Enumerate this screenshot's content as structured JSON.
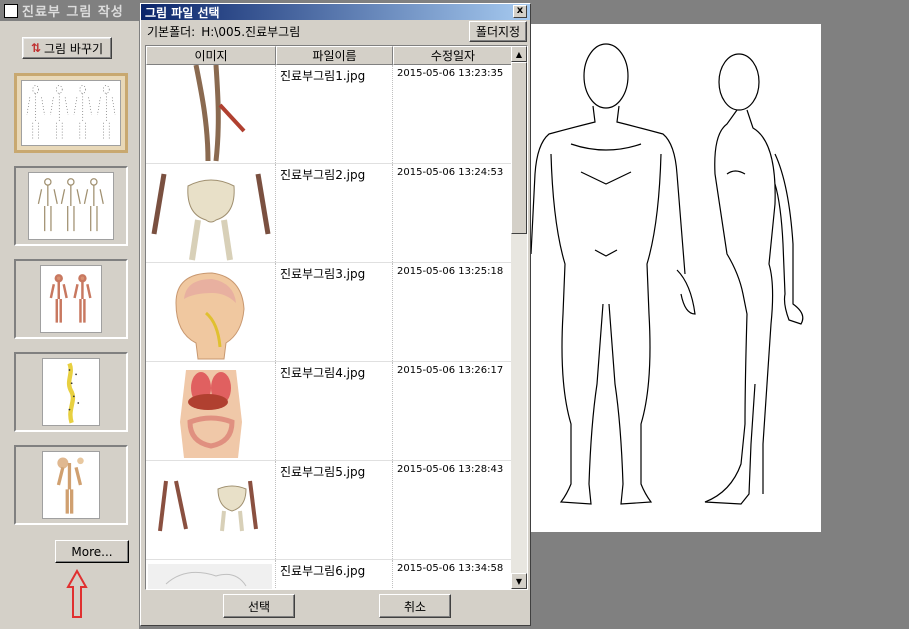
{
  "app": {
    "title": "진료부 그림 작성"
  },
  "left_panel": {
    "swap_button": "그림 바꾸기",
    "more_button": "More...",
    "thumbnails": [
      "thumb-1",
      "thumb-2",
      "thumb-3",
      "thumb-4",
      "thumb-5"
    ]
  },
  "dialog": {
    "title": "그림 파일 선택",
    "close_label": "x",
    "folder_label": "기본폴더:",
    "folder_path": "H:\\005.진료부그림",
    "folder_button": "폴더지정",
    "columns": [
      "이미지",
      "파일이름",
      "수정일자"
    ],
    "rows": [
      {
        "name": "진료부그림1.jpg",
        "date": "2015-05-06 13:23:35"
      },
      {
        "name": "진료부그림2.jpg",
        "date": "2015-05-06 13:24:53"
      },
      {
        "name": "진료부그림3.jpg",
        "date": "2015-05-06 13:25:18"
      },
      {
        "name": "진료부그림4.jpg",
        "date": "2015-05-06 13:26:17"
      },
      {
        "name": "진료부그림5.jpg",
        "date": "2015-05-06 13:28:43"
      },
      {
        "name": "진료부그림6.jpg",
        "date": "2015-05-06 13:34:58"
      }
    ],
    "select_button": "선택",
    "cancel_button": "취소"
  },
  "colors": {
    "title_gradient_start": "#0a246a",
    "title_gradient_end": "#a6caf0",
    "arrow": "#e03030"
  }
}
